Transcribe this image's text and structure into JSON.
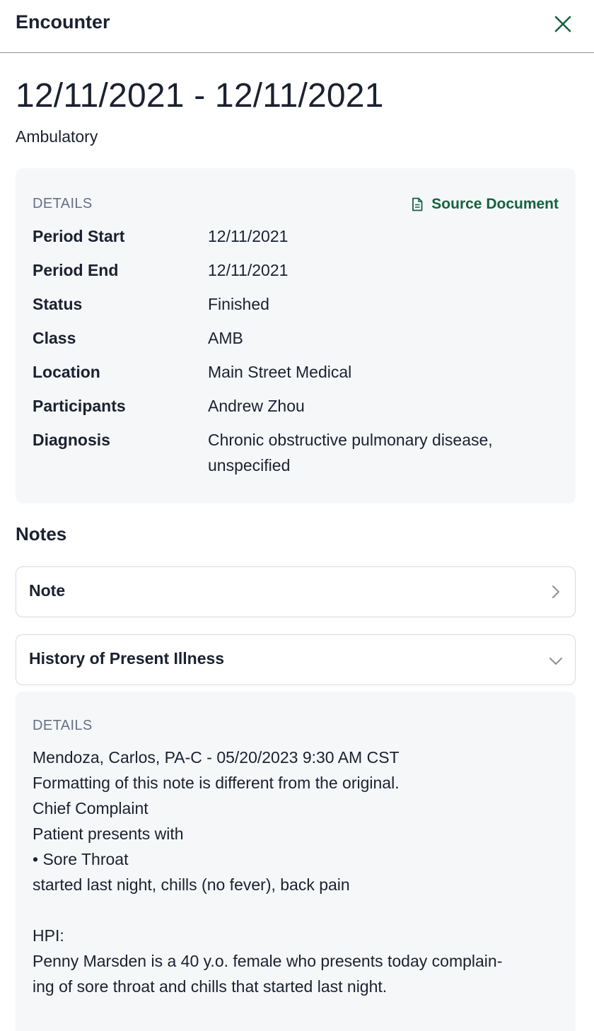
{
  "header": {
    "title": "Encounter"
  },
  "encounter": {
    "date_range": "12/11/2021 - 12/11/2021",
    "type": "Ambulatory"
  },
  "details": {
    "label": "DETAILS",
    "source_document": "Source Document",
    "rows": [
      {
        "key": "Period Start",
        "value": "12/11/2021"
      },
      {
        "key": "Period End",
        "value": "12/11/2021"
      },
      {
        "key": "Status",
        "value": "Finished"
      },
      {
        "key": "Class",
        "value": "AMB"
      },
      {
        "key": "Location",
        "value": "Main Street Medical"
      },
      {
        "key": "Participants",
        "value": "Andrew Zhou"
      },
      {
        "key": "Diagnosis",
        "value": "Chronic obstructive pulmonary disease, unspecified"
      }
    ]
  },
  "notes": {
    "title": "Notes",
    "items": [
      {
        "label": "Note",
        "icon": "chevron-right-icon"
      },
      {
        "label": "History of Present Illness",
        "icon": "chevron-down-icon"
      }
    ],
    "expanded": {
      "label": "DETAILS",
      "lines": [
        "Mendoza, Carlos, PA-C - 05/20/2023 9:30 AM CST",
        "Formatting of this note is different from the original.",
        "Chief Complaint",
        "Patient presents with",
        "• Sore Throat",
        "started last night, chills (no fever), back pain",
        "HPI:",
        "Penny Marsden is a 40 y.o. female who presents today complain-",
        "ing of sore throat and chills that started last night."
      ]
    }
  },
  "colors": {
    "accent": "#13633f",
    "card_bg": "#f6f7f9",
    "muted": "#667085"
  }
}
